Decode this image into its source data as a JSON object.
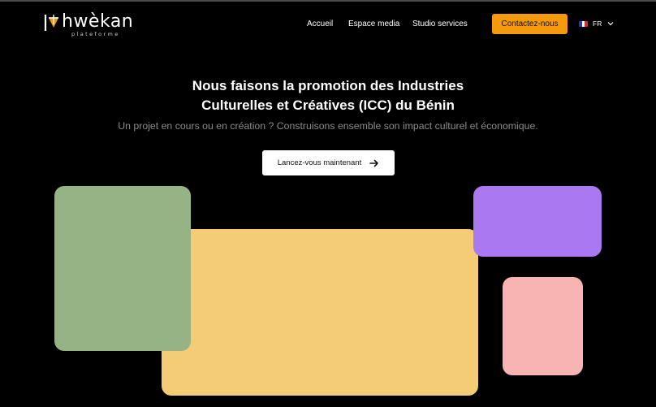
{
  "header": {
    "logo": {
      "name": "hwèkan",
      "tagline": "plateforme"
    },
    "nav": [
      {
        "label": "Accueil"
      },
      {
        "label": "Espace media"
      },
      {
        "label": "Studio services"
      }
    ],
    "contact_label": "Contactez-nous",
    "language": {
      "selected": "FR",
      "flag_icon": "flag-france-icon"
    }
  },
  "hero": {
    "title_line1": "Nous faisons la promotion des Industries",
    "title_line2": "Culturelles et Créatives (ICC) du Bénin",
    "subtitle": "Un projet en cours ou en création ? Construisons ensemble son impact culturel et économique.",
    "cta_label": "Lancez-vous maintenant",
    "cta_icon": "arrow-right-icon"
  },
  "colors": {
    "background": "#000000",
    "accent": "#f59a0c",
    "tile_green": "#95b384",
    "tile_yellow": "#f3cc75",
    "tile_purple": "#aa79f2",
    "tile_pink": "#f8b4b3"
  }
}
